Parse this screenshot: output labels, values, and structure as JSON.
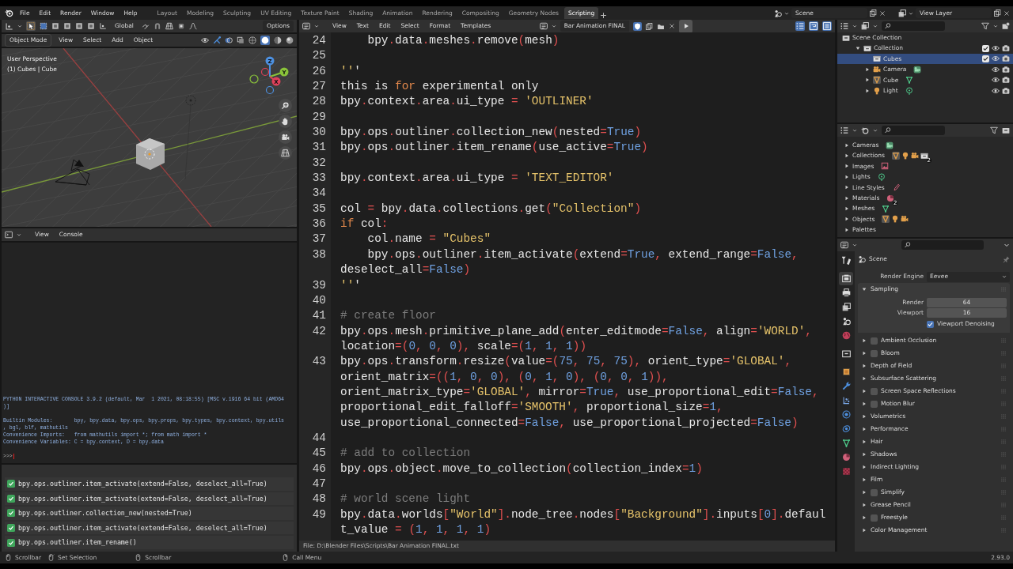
{
  "menu": [
    "File",
    "Edit",
    "Render",
    "Window",
    "Help"
  ],
  "workspaces": [
    {
      "label": "Layout",
      "selected": false
    },
    {
      "label": "Modeling",
      "selected": false
    },
    {
      "label": "Sculpting",
      "selected": false
    },
    {
      "label": "UV Editing",
      "selected": false
    },
    {
      "label": "Texture Paint",
      "selected": false
    },
    {
      "label": "Shading",
      "selected": false
    },
    {
      "label": "Animation",
      "selected": false
    },
    {
      "label": "Rendering",
      "selected": false
    },
    {
      "label": "Compositing",
      "selected": false
    },
    {
      "label": "Geometry Nodes",
      "selected": false
    },
    {
      "label": "Scripting",
      "selected": true
    }
  ],
  "scene": "Scene",
  "view_layer": "View Layer",
  "viewport": {
    "orientation": "Global",
    "options": "Options",
    "mode": "Object Mode",
    "menus": [
      "View",
      "Select",
      "Add",
      "Object"
    ],
    "overlay": [
      "User Perspective",
      "(1) Cubes | Cube"
    ],
    "gizmo_axes": [
      "Z",
      "Y",
      "X"
    ]
  },
  "console": {
    "menus": [
      "View",
      "Console"
    ],
    "rows": [
      "PYTHON INTERACTIVE CONSOLE 3.9.2 (default, Mar  1 2021, 08:18:55) [MSC v.1916 64 bit (AMD64",
      ")]",
      null,
      "Builtin Modules:       bpy, bpy.data, bpy.ops, bpy.props, bpy.types, bpy.context, bpy.utils",
      ", bgl, blf, mathutils",
      "Convenience Imports:   from mathutils import *; from math import *",
      "Convenience Variables: C = bpy.context, D = bpy.data",
      null
    ],
    "prompt": ">>>"
  },
  "info_log": [
    {
      "text": "bpy.ops.outliner.item_activate(extend=False, deselect_all=True)",
      "done": true
    },
    {
      "text": "bpy.ops.outliner.item_activate(extend=False, deselect_all=True)",
      "done": true
    },
    {
      "text": "bpy.ops.outliner.collection_new(nested=True)",
      "done": true
    },
    {
      "text": "bpy.ops.outliner.item_activate(extend=False, deselect_all=True)",
      "done": true
    },
    {
      "text": "bpy.ops.outliner.item_rename()",
      "done": true
    }
  ],
  "text_editor": {
    "menus": [
      "View",
      "Text",
      "Edit",
      "Select",
      "Format",
      "Templates"
    ],
    "file_name": "Bar Animation FINAL",
    "fake_user": true,
    "line_numbers": true,
    "word_wrap": true,
    "syntax_highlight": true,
    "lines": [
      {
        "number": "24",
        "rows": [
          "    bpy.data.meshes.remove(mesh)"
        ]
      },
      {
        "number": "25"
      },
      {
        "number": "26",
        "rows": [
          "'''"
        ]
      },
      {
        "number": "27",
        "rows": [
          "this is for experimental only"
        ]
      },
      {
        "number": "28",
        "rows": [
          "bpy.context.area.ui_type = 'OUTLINER'"
        ]
      },
      {
        "number": "29"
      },
      {
        "number": "30",
        "rows": [
          "bpy.ops.outliner.collection_new(nested=True)"
        ]
      },
      {
        "number": "31",
        "rows": [
          "bpy.ops.outliner.item_rename(use_active=True)"
        ]
      },
      {
        "number": "32"
      },
      {
        "number": "33",
        "rows": [
          "bpy.context.area.ui_type = 'TEXT_EDITOR'"
        ]
      },
      {
        "number": "34"
      },
      {
        "number": "35",
        "rows": [
          "col = bpy.data.collections.get(\"Collection\")"
        ]
      },
      {
        "number": "36",
        "rows": [
          "if col:"
        ]
      },
      {
        "number": "37",
        "rows": [
          "    col.name = \"Cubes\""
        ]
      },
      {
        "number": "38",
        "rows": [
          "    bpy.ops.outliner.item_activate(extend=True, extend_range=False,",
          "deselect_all=False)"
        ]
      },
      {
        "number": "39",
        "rows": [
          "'''"
        ]
      },
      {
        "number": "40"
      },
      {
        "number": "41",
        "rows": [
          "# create floor"
        ]
      },
      {
        "number": "42",
        "rows": [
          "bpy.ops.mesh.primitive_plane_add(enter_editmode=False, align='WORLD',",
          "location=(0, 0, 0), scale=(1, 1, 1))"
        ]
      },
      {
        "number": "43",
        "rows": [
          "bpy.ops.transform.resize(value=(75, 75, 75), orient_type='GLOBAL',",
          "orient_matrix=((1, 0, 0), (0, 1, 0), (0, 0, 1)),",
          "orient_matrix_type='GLOBAL', mirror=True, use_proportional_edit=False,",
          "proportional_edit_falloff='SMOOTH', proportional_size=1,",
          "use_proportional_connected=False, use_proportional_projected=False)"
        ]
      },
      {
        "number": "44"
      },
      {
        "number": "45",
        "rows": [
          "# add to collection"
        ]
      },
      {
        "number": "46",
        "rows": [
          "bpy.ops.object.move_to_collection(collection_index=1)"
        ]
      },
      {
        "number": "47"
      },
      {
        "number": "48",
        "rows": [
          "# world scene light"
        ]
      },
      {
        "number": "49",
        "rows": [
          "bpy.data.worlds[\"World\"].node_tree.nodes[\"Background\"].inputs[0].defaul",
          "t_value = (1, 1, 1, 1)"
        ]
      }
    ],
    "footer": "File: D:\\Blender Files\\Scripts\\Bar Animation FINAL.txt"
  },
  "outliner": {
    "tree": [
      {
        "label": "Scene Collection",
        "kind": "scene",
        "children": [
          {
            "label": "Collection",
            "kind": "collection",
            "expanded": true,
            "checked": true,
            "visible": true,
            "selected": false,
            "children": [
              {
                "label": "Cubes",
                "kind": "collection",
                "checked": true,
                "visible": true,
                "selected": true
              },
              {
                "label": "Camera",
                "kind": "camera",
                "expanded": false,
                "visible": true,
                "selected": false
              },
              {
                "label": "Cube",
                "kind": "mesh",
                "expanded": false,
                "visible": true,
                "selected": false
              },
              {
                "label": "Light",
                "kind": "light",
                "expanded": false,
                "visible": true,
                "selected": false
              }
            ]
          }
        ]
      }
    ]
  },
  "blend_file": {
    "items": [
      {
        "label": "Cameras",
        "kind": "cameras",
        "expanded": false
      },
      {
        "label": "Collections",
        "kind": "collections",
        "expanded": false,
        "count": "2"
      },
      {
        "label": "Images",
        "kind": "images",
        "expanded": false
      },
      {
        "label": "Lights",
        "kind": "lights",
        "expanded": false
      },
      {
        "label": "Line Styles",
        "kind": "linestyles",
        "expanded": false
      },
      {
        "label": "Materials",
        "kind": "materials",
        "expanded": false,
        "count": "2"
      },
      {
        "label": "Meshes",
        "kind": "meshes",
        "expanded": false
      },
      {
        "label": "Objects",
        "kind": "objects",
        "expanded": false
      },
      {
        "label": "Palettes",
        "kind": "palettes",
        "expanded": false
      }
    ]
  },
  "properties": {
    "tabs": [
      {
        "kind": "tool",
        "selected": false
      },
      {
        "kind": "render",
        "selected": true
      },
      {
        "kind": "output",
        "selected": false
      },
      {
        "kind": "view_layer",
        "selected": false
      },
      {
        "kind": "scene",
        "selected": false
      },
      {
        "kind": "world",
        "selected": false
      },
      {
        "kind": "collection",
        "selected": false
      },
      {
        "kind": "object",
        "selected": false
      },
      {
        "kind": "modifier",
        "selected": false
      },
      {
        "kind": "particles",
        "selected": false
      },
      {
        "kind": "physics",
        "selected": false
      },
      {
        "kind": "constraints",
        "selected": false
      },
      {
        "kind": "data",
        "selected": false
      },
      {
        "kind": "material",
        "selected": false
      },
      {
        "kind": "texture",
        "selected": false
      }
    ],
    "context": "Scene",
    "render_engine": {
      "label": "Render Engine",
      "value": "Eevee"
    },
    "panels": [
      {
        "label": "Sampling",
        "expanded": true,
        "fields": [
          {
            "label": "Render",
            "value": "64"
          },
          {
            "label": "Viewport",
            "value": "16"
          }
        ],
        "options": [
          {
            "label": "Viewport Denoising",
            "checked": true
          }
        ]
      },
      {
        "label": "Ambient Occlusion",
        "expanded": false,
        "enabled": false
      },
      {
        "label": "Bloom",
        "expanded": false,
        "enabled": false
      },
      {
        "label": "Depth of Field",
        "expanded": false
      },
      {
        "label": "Subsurface Scattering",
        "expanded": false
      },
      {
        "label": "Screen Space Reflections",
        "expanded": false,
        "enabled": false
      },
      {
        "label": "Motion Blur",
        "expanded": false,
        "enabled": false
      },
      {
        "label": "Volumetrics",
        "expanded": false
      },
      {
        "label": "Performance",
        "expanded": false
      },
      {
        "label": "Hair",
        "expanded": false
      },
      {
        "label": "Shadows",
        "expanded": false
      },
      {
        "label": "Indirect Lighting",
        "expanded": false
      },
      {
        "label": "Film",
        "expanded": false
      },
      {
        "label": "Simplify",
        "expanded": false,
        "enabled": false
      },
      {
        "label": "Grease Pencil",
        "expanded": false
      },
      {
        "label": "Freestyle",
        "expanded": false,
        "enabled": false
      },
      {
        "label": "Color Management",
        "expanded": false
      }
    ]
  },
  "status_bar": {
    "hints": [
      {
        "kind": "left",
        "label": "Scrollbar"
      },
      {
        "kind": "drag",
        "label": "Set Selection"
      },
      {
        "kind": "middle",
        "label": "Scrollbar"
      },
      {
        "kind": "right",
        "label": "Call Menu"
      }
    ],
    "version": "2.93.0"
  }
}
